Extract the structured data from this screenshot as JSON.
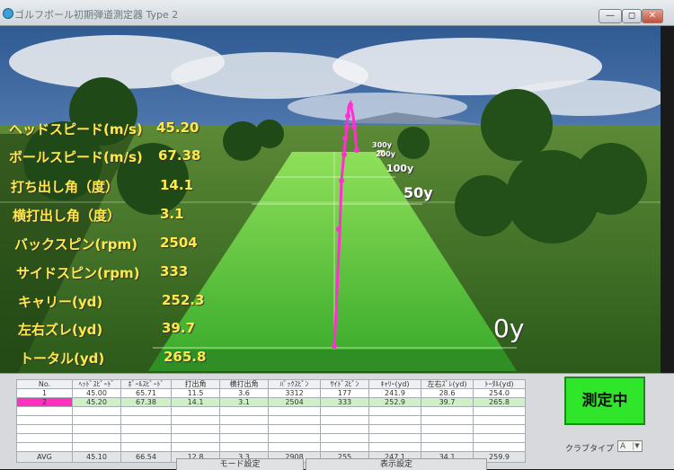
{
  "window": {
    "title": "ゴルフボール初期弾道測定器 Type 2",
    "minimize": "—",
    "maximize": "◻",
    "close": "✕"
  },
  "stats": [
    {
      "label": "ヘッドスピード(m/s)",
      "value": "45.20"
    },
    {
      "label": "ボールスピード(m/s)",
      "value": "67.38"
    },
    {
      "label": "打ち出し角（度）",
      "value": "14.1"
    },
    {
      "label": "横打出し角（度）",
      "value": "3.1"
    },
    {
      "label": "バックスピン(rpm)",
      "value": "2504"
    },
    {
      "label": "サイドスピン(rpm)",
      "value": "333"
    },
    {
      "label": "キャリー(yd)",
      "value": "252.3"
    },
    {
      "label": "左右ズレ(yd)",
      "value": "39.7"
    },
    {
      "label": "トータル(yd)",
      "value": "265.8"
    }
  ],
  "distance_markers": {
    "d0": "0y",
    "d50": "50y",
    "d100": "100y",
    "d200": "200y",
    "d300": "300y"
  },
  "table": {
    "headers": [
      "No.",
      "ﾍｯﾄﾞｽﾋﾟｰﾄﾞ",
      "ﾎﾞｰﾙｽﾋﾟｰﾄﾞ",
      "打出角",
      "横打出角",
      "ﾊﾞｯｸｽﾋﾟﾝ",
      "ｻｲﾄﾞｽﾋﾟﾝ",
      "ｷｬﾘｰ(yd)",
      "左右ｽﾞﾚ(yd)",
      "ﾄｰﾀﾙ(yd)"
    ],
    "rows": [
      [
        "1",
        "45.00",
        "65.71",
        "11.5",
        "3.6",
        "3312",
        "177",
        "241.9",
        "28.6",
        "254.0"
      ],
      [
        "2",
        "45.20",
        "67.38",
        "14.1",
        "3.1",
        "2504",
        "333",
        "252.9",
        "39.7",
        "265.8"
      ]
    ],
    "avg": [
      "AVG",
      "45.10",
      "66.54",
      "12.8",
      "3.3",
      "2908",
      "255",
      "247.1",
      "34.1",
      "259.9"
    ]
  },
  "measure_button": "測定中",
  "club_type": {
    "label": "クラブタイプ",
    "value": "A"
  },
  "tabs": {
    "mode": "モード設定",
    "display": "表示設定"
  },
  "colors": {
    "stat_text": "#ffe94a",
    "trajectory": "#ff2fd0",
    "measure_button": "#2fe62a",
    "selected_row": "#cfefc9"
  }
}
